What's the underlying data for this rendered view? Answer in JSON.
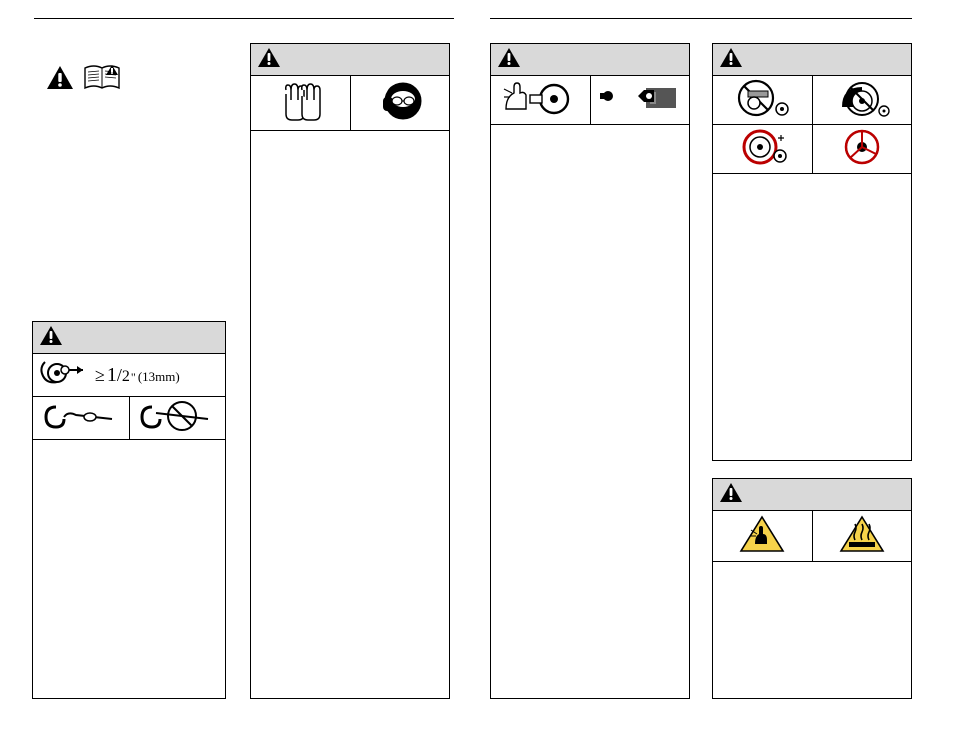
{
  "icons": {
    "warning": "warning-triangle",
    "manual": "read-manual",
    "gloves": "wear-gloves",
    "ear_eye": "wear-ear-eye-protection",
    "disc_arrow": "disc-with-arrow",
    "hook_ok": "hook-correct",
    "hook_no": "hook-prohibited",
    "hand_disc": "hand-near-disc",
    "wrench": "use-wrench",
    "no_grind": "no-side-grinding",
    "no_guard_remove": "do-not-remove-guard",
    "disc_red1": "damaged-disc-warning",
    "disc_red2": "cracked-disc-warning",
    "cut_hand": "cut-hazard",
    "hot_surface": "hot-surface-hazard"
  },
  "dimension": {
    "ge": "≥",
    "whole": "1",
    "num": "1",
    "den": "2",
    "inch": "\"",
    "mm": "(13mm)"
  }
}
